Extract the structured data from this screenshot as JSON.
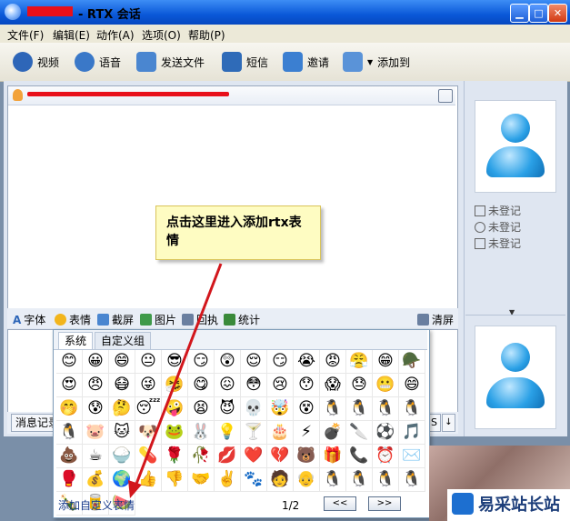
{
  "window": {
    "title": "- RTX 会话"
  },
  "menu": [
    {
      "label": "文件(F)"
    },
    {
      "label": "编辑(E)"
    },
    {
      "label": "动作(A)"
    },
    {
      "label": "选项(O)"
    },
    {
      "label": "帮助(P)"
    }
  ],
  "toolbar": [
    {
      "label": "视频",
      "icon": "video-icon",
      "color": "#2e66b8"
    },
    {
      "label": "语音",
      "icon": "microphone-icon",
      "color": "#3a78c8"
    },
    {
      "label": "发送文件",
      "icon": "send-file-icon",
      "color": "#4a86d0"
    },
    {
      "label": "短信",
      "icon": "sms-icon",
      "color": "#2f6bb8"
    },
    {
      "label": "邀请",
      "icon": "invite-icon",
      "color": "#3b7fd1"
    },
    {
      "label": "添加到",
      "icon": "add-to-icon",
      "color": "#5a93d8"
    }
  ],
  "format_bar": [
    {
      "label": "字体",
      "icon": "font-icon",
      "color": "#2e66b8"
    },
    {
      "label": "表情",
      "icon": "emoticon-icon",
      "color": "#f2b51c"
    },
    {
      "label": "截屏",
      "icon": "screenshot-icon",
      "color": "#4a86d0"
    },
    {
      "label": "图片",
      "icon": "picture-icon",
      "color": "#3f9a4a"
    },
    {
      "label": "回执",
      "icon": "receipt-icon",
      "color": "#6a7fa0"
    },
    {
      "label": "统计",
      "icon": "statistics-icon",
      "color": "#3a8a3a"
    }
  ],
  "clear_label": "清屏",
  "message_record_label": "消息记录",
  "contact_info": [
    "未登记",
    "未登记",
    "未登记"
  ],
  "callout": {
    "text": "点击这里进入添加rtx表情"
  },
  "emoji_popup": {
    "tabs": [
      "系统",
      "自定义组"
    ],
    "emoticons": [
      "😊",
      "😀",
      "😄",
      "😐",
      "😎",
      "😏",
      "😲",
      "😌",
      "😏",
      "😭",
      "😡",
      "😤",
      "😁",
      "🪖",
      "😍",
      "😠",
      "😷",
      "😜",
      "🤧",
      "😋",
      "😖",
      "😳",
      "😢",
      "😯",
      "😱",
      "😓",
      "😬",
      "😄",
      "🤭",
      "😰",
      "🤔",
      "😴",
      "🤪",
      "😫",
      "😈",
      "💀",
      "🤯",
      "😵",
      "🐧",
      "🐧",
      "🐧",
      "🐧",
      "🐧",
      "🐷",
      "🐱",
      "🐶",
      "🐸",
      "🐰",
      "💡",
      "🍸",
      "🎂",
      "⚡",
      "💣",
      "🔪",
      "⚽",
      "🎵",
      "💩",
      "☕",
      "🍚",
      "💊",
      "🌹",
      "🥀",
      "💋",
      "❤️",
      "💔",
      "🐻",
      "🎁",
      "📞",
      "⏰",
      "✉️",
      "🥊",
      "💰",
      "🌍",
      "👍",
      "👎",
      "🤝",
      "✌️",
      "🐾",
      "🧑",
      "👴",
      "🐧",
      "🐧",
      "🐧",
      "🐧",
      "🍾",
      "🥫",
      "🍉"
    ],
    "add_custom_label": "添加自定义表情",
    "page": "1/2",
    "prev_label": "<<",
    "next_label": ">>"
  },
  "watermark": {
    "text": "易采站长站"
  }
}
